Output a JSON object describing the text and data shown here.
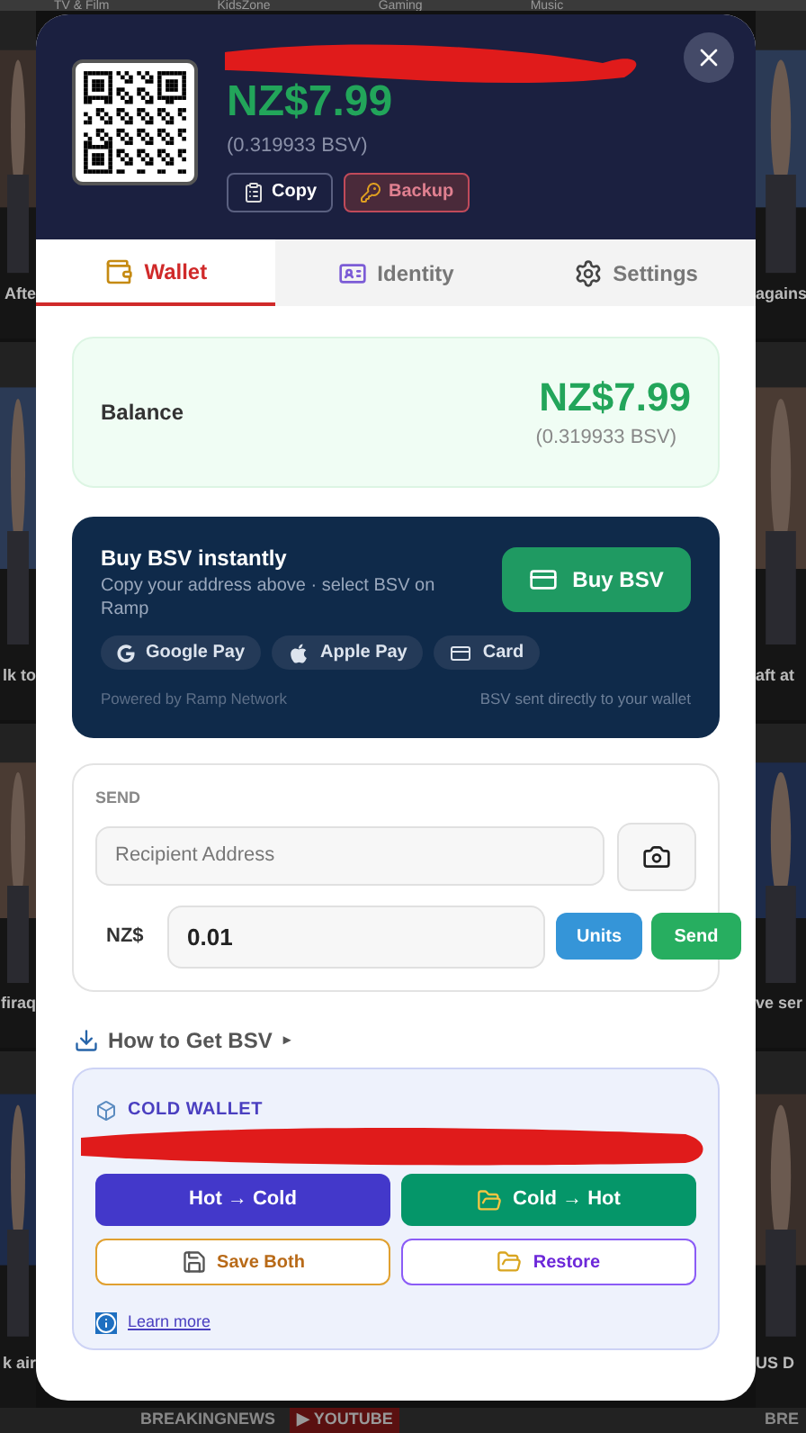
{
  "background": {
    "nav": [
      "TV & Film",
      "KidsZone",
      "Gaming",
      "Music"
    ],
    "left_captions": [
      "Afte",
      "lk to",
      "firaq",
      "k air"
    ],
    "right_captions": [
      "agains",
      "aft at",
      "ve ser",
      "US D"
    ],
    "ticker": [
      "BREAKINGNEWS",
      "▶ YOUTUBE",
      "BRE"
    ]
  },
  "header": {
    "amount": "NZ$7.99",
    "bsv": "(0.319933 BSV)",
    "buttons": [
      {
        "label": "Copy",
        "kind": "copy"
      },
      {
        "label": "Backup",
        "kind": "backup"
      }
    ]
  },
  "tabs": [
    {
      "label": "Wallet",
      "kind": "wallet",
      "selected": true
    },
    {
      "label": "Identity",
      "kind": "identity",
      "selected": false
    },
    {
      "label": "Settings",
      "kind": "settings",
      "selected": false
    }
  ],
  "balance": {
    "label": "Balance",
    "amount": "NZ$7.99",
    "bsv": "(0.319933 BSV)"
  },
  "buy": {
    "title": "Buy BSV instantly",
    "subtitle": "Copy your address above · select BSV on Ramp",
    "button": "Buy BSV",
    "methods": [
      {
        "label": "Google Pay",
        "kind": "google"
      },
      {
        "label": "Apple Pay",
        "kind": "apple"
      },
      {
        "label": "Card",
        "kind": "card"
      }
    ],
    "footer_left": "Powered by Ramp Network",
    "footer_right": "BSV sent directly to your wallet"
  },
  "send": {
    "title": "SEND",
    "address": {
      "placeholder": "Recipient Address"
    },
    "currency": "NZ$",
    "amount": "0.01",
    "units_button": "Units",
    "send_button": "Send"
  },
  "how_to": {
    "label": "How to Get BSV",
    "marker": "▸"
  },
  "cold_wallet": {
    "title": "COLD WALLET",
    "buttons": [
      {
        "label": "Hot → Cold",
        "kind": "solid-indigo"
      },
      {
        "label": "Cold → Hot",
        "kind": "solid-green"
      },
      {
        "label": "Save Both",
        "kind": "outline-amber"
      },
      {
        "label": "Restore",
        "kind": "outline-purple"
      }
    ],
    "link": "Learn more"
  }
}
